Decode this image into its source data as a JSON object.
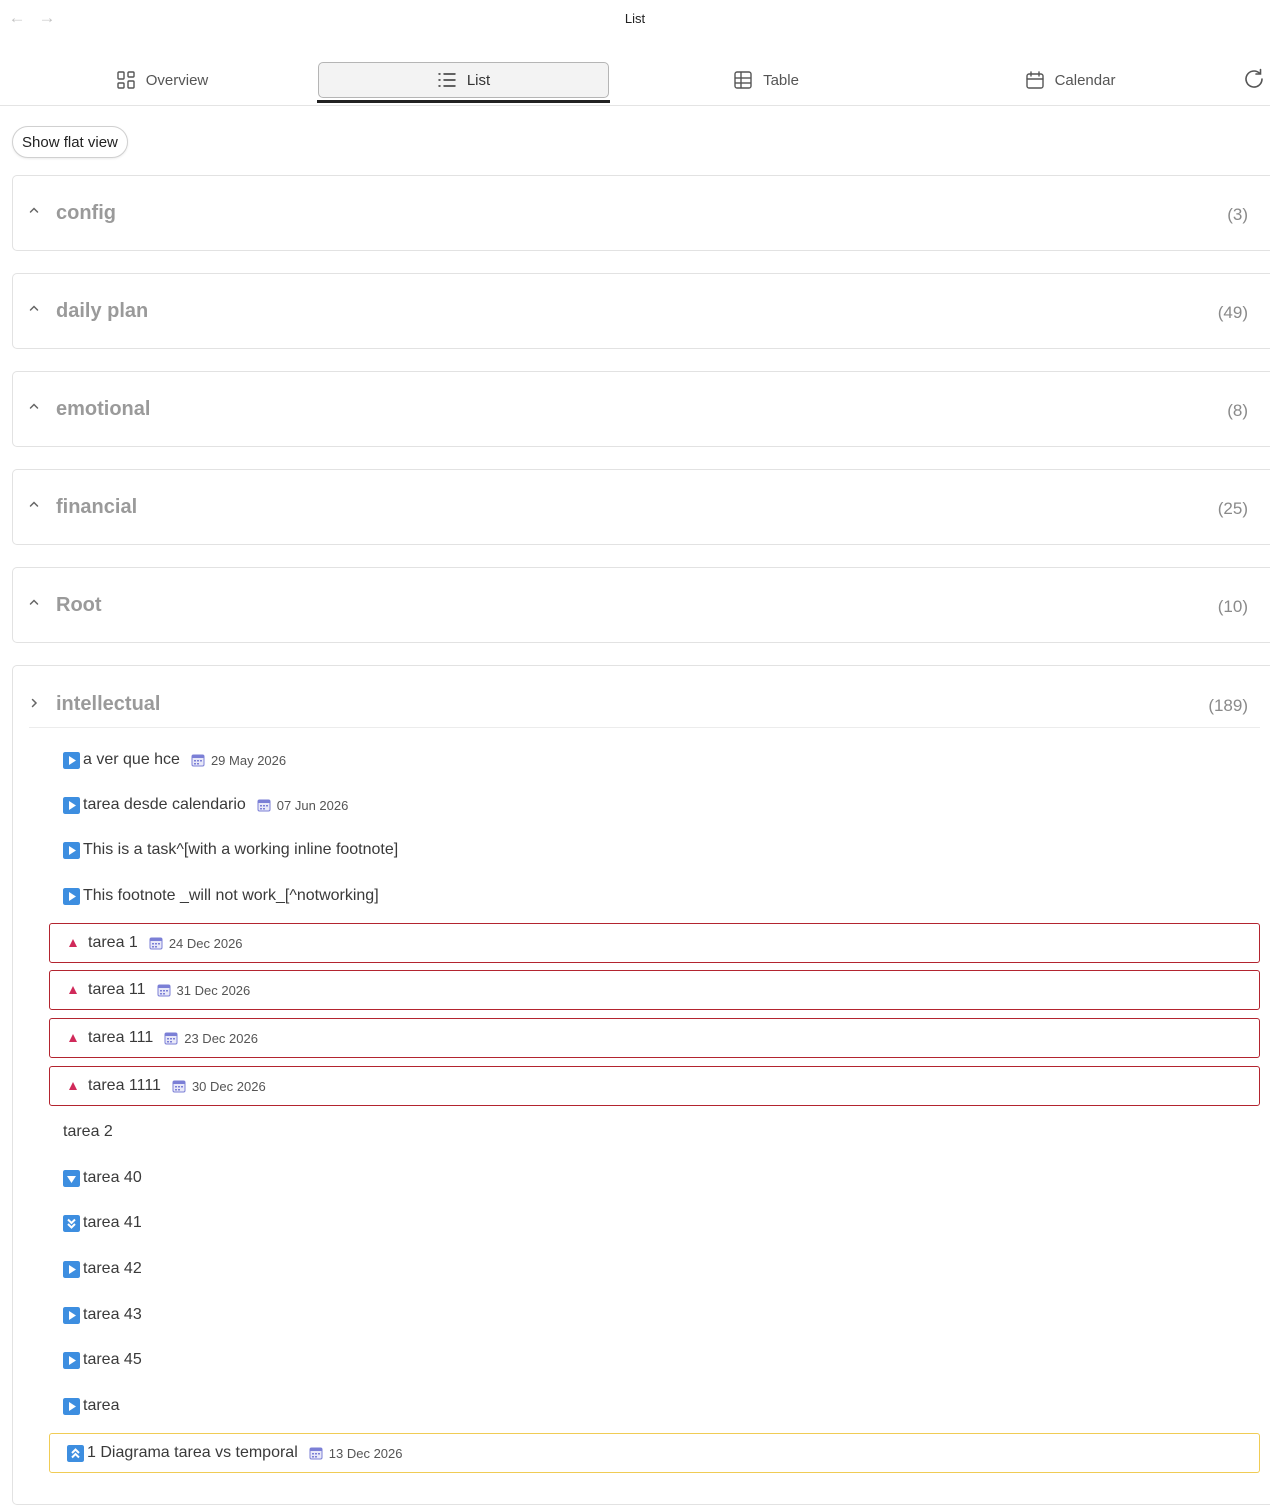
{
  "window": {
    "title": "List"
  },
  "tabs": [
    {
      "label": "Overview",
      "icon": "grid-icon"
    },
    {
      "label": "List",
      "icon": "list-icon",
      "active": true
    },
    {
      "label": "Table",
      "icon": "table-icon"
    },
    {
      "label": "Calendar",
      "icon": "calendar-icon"
    }
  ],
  "toolbar": {
    "flat_view_label": "Show flat view"
  },
  "groups": [
    {
      "name": "config",
      "count": "(3)"
    },
    {
      "name": "daily plan",
      "count": "(49)"
    },
    {
      "name": "emotional",
      "count": "(8)"
    },
    {
      "name": "financial",
      "count": "(25)"
    },
    {
      "name": "Root",
      "count": "(10)"
    },
    {
      "name": "intellectual",
      "count": "(189)",
      "expanded": true
    }
  ],
  "tasks": [
    {
      "text": "a ver que hce",
      "due": "29 May 2026",
      "priority": "medium"
    },
    {
      "text": "tarea desde calendario",
      "due": "07 Jun 2026",
      "priority": "medium"
    },
    {
      "text": "This is a task^[with a working inline footnote]",
      "due": "",
      "priority": "medium"
    },
    {
      "text": "This footnote _will not work_[^notworking]",
      "due": "",
      "priority": "medium"
    },
    {
      "text": "tarea 1",
      "due": "24 Dec 2026",
      "priority": "high"
    },
    {
      "text": "tarea 11",
      "due": "31 Dec 2026",
      "priority": "high"
    },
    {
      "text": "tarea 111",
      "due": "23 Dec 2026",
      "priority": "high"
    },
    {
      "text": "tarea 1111",
      "due": "30 Dec 2026",
      "priority": "high"
    },
    {
      "text": "tarea 2",
      "due": "",
      "priority": "none"
    },
    {
      "text": "tarea 40",
      "due": "",
      "priority": "low"
    },
    {
      "text": "tarea 41",
      "due": "",
      "priority": "lowest"
    },
    {
      "text": "tarea 42",
      "due": "",
      "priority": "medium"
    },
    {
      "text": "tarea 43",
      "due": "",
      "priority": "medium"
    },
    {
      "text": "tarea 45",
      "due": "",
      "priority": "medium"
    },
    {
      "text": "tarea",
      "due": "",
      "priority": "medium"
    },
    {
      "text": "1 Diagrama tarea vs temporal",
      "due": "13 Dec 2026",
      "priority": "highest"
    }
  ],
  "colors": {
    "accent": "#222222",
    "high_border": "#b3242f",
    "highest_border": "#f0cc55",
    "priority_blue": "#3d8ee0",
    "priority_red": "#d02a5a"
  }
}
